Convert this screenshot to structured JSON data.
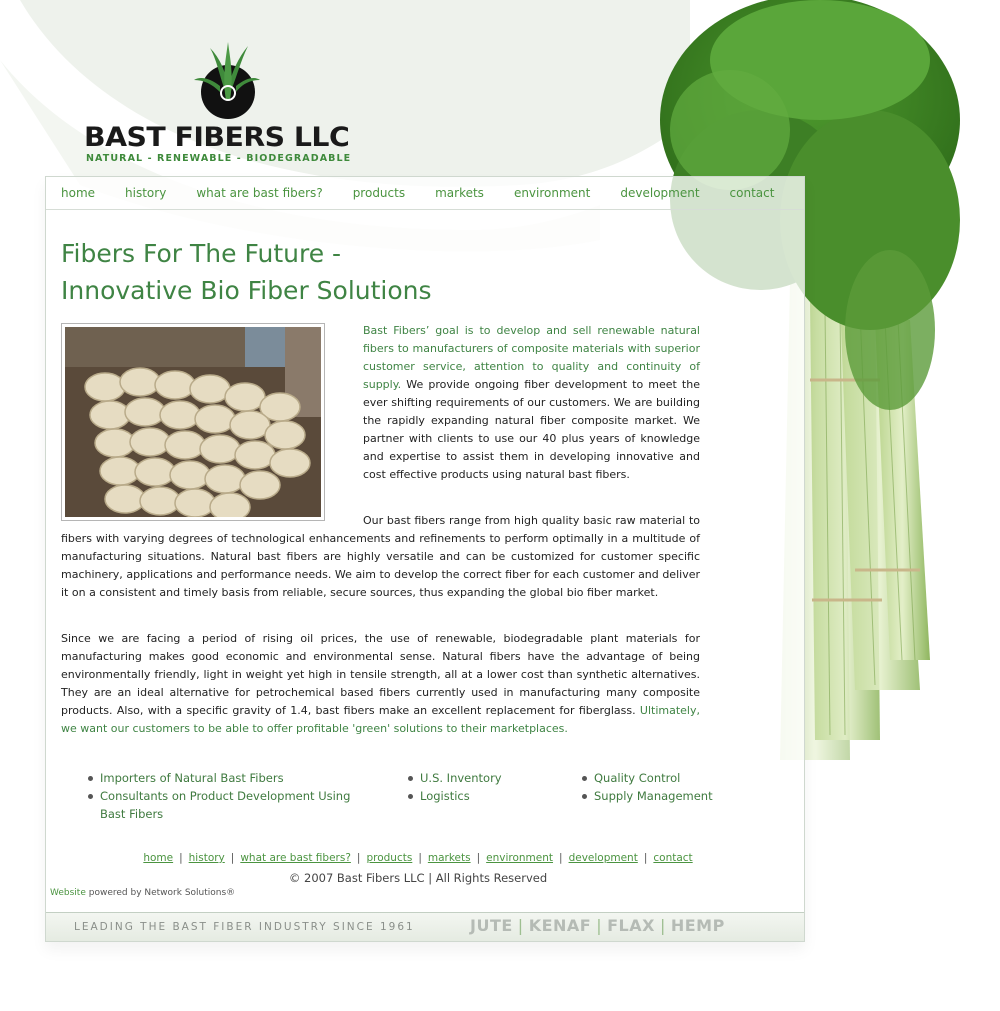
{
  "logo": {
    "name": "BAST FIBERS LLC",
    "tagline": "NATURAL - RENEWABLE - BIODEGRADABLE"
  },
  "nav": {
    "items": [
      "home",
      "history",
      "what are bast fibers?",
      "products",
      "markets",
      "environment",
      "development",
      "contact"
    ]
  },
  "headline": {
    "line1": "Fibers For The Future -",
    "line2": "Innovative Bio Fiber Solutions"
  },
  "body": {
    "p1_green": "Bast Fibers’ goal is to develop and sell renewable natural fibers to manufacturers of composite materials with superior customer service, attention to quality and continuity of supply.",
    "p1_rest": " We provide ongoing fiber development to meet the ever shifting requirements of our customers. We are building the rapidly expanding natural fiber composite market. We partner with clients to use our 40 plus years of knowledge and expertise to assist them in developing innovative and cost effective products using natural bast fibers.",
    "p2": "Our bast fibers range from high quality basic raw material to fibers with varying degrees of technological enhancements and refinements to perform optimally in a multitude of manufacturing situations. Natural bast fibers are highly versatile and can be customized for customer specific machinery, applications and performance needs. We aim to develop the correct fiber for each customer and deliver it on a consistent and timely basis from reliable, secure sources, thus expanding the global bio fiber market.",
    "p3": "Since we are facing a period of rising oil prices, the use of renewable, biodegradable plant materials for manufacturing makes good economic and environmental sense. Natural fibers have the advantage of being environmentally friendly, light in weight yet high in tensile strength, all at a lower cost than synthetic alternatives. They are an ideal alternative for petrochemical based fibers currently used in manufacturing many composite products. Also, with a specific gravity of 1.4, bast fibers make an excellent replacement for fiberglass.",
    "p3_green": " Ultimately, we want our customers to be able to offer profitable 'green' solutions to their marketplaces."
  },
  "bullets": {
    "col1": [
      "Importers of Natural Bast Fibers",
      "Consultants on Product Development Using Bast Fibers"
    ],
    "col2": [
      "U.S. Inventory",
      "Logistics"
    ],
    "col3": [
      "Quality Control",
      "Supply Management"
    ]
  },
  "footer": {
    "links": [
      "home",
      "history",
      "what are bast fibers?",
      "products",
      "markets",
      "environment",
      "development",
      "contact"
    ],
    "copyright": "© 2007 Bast Fibers LLC | All Rights Reserved",
    "powered_link": "Website",
    "powered_text": " powered by Network Solutions®"
  },
  "banner": {
    "left": "LEADING THE BAST FIBER INDUSTRY SINCE 1961",
    "right": [
      "JUTE",
      "KENAF",
      "FLAX",
      "HEMP"
    ]
  },
  "colors": {
    "accent_green": "#3f8444",
    "link_green": "#4b9440"
  }
}
